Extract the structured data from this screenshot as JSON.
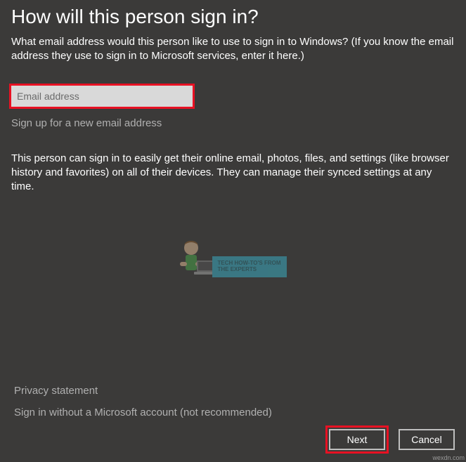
{
  "title": "How will this person sign in?",
  "intro": "What email address would this person like to use to sign in to Windows? (If you know the email address they use to sign in to Microsoft services, enter it here.)",
  "email": {
    "placeholder": "Email address",
    "value": ""
  },
  "signup_link": "Sign up for a new email address",
  "description": "This person can sign in to easily get their online email, photos, files, and settings (like browser history and favorites) on all of their devices. They can manage their synced settings at any time.",
  "privacy_link": "Privacy statement",
  "no_ms_link": "Sign in without a Microsoft account (not recommended)",
  "buttons": {
    "next": "Next",
    "cancel": "Cancel"
  },
  "watermark": {
    "line1": "TECH HOW-TO'S FROM",
    "line2": "THE EXPERTS",
    "source": "wexdn.com"
  }
}
